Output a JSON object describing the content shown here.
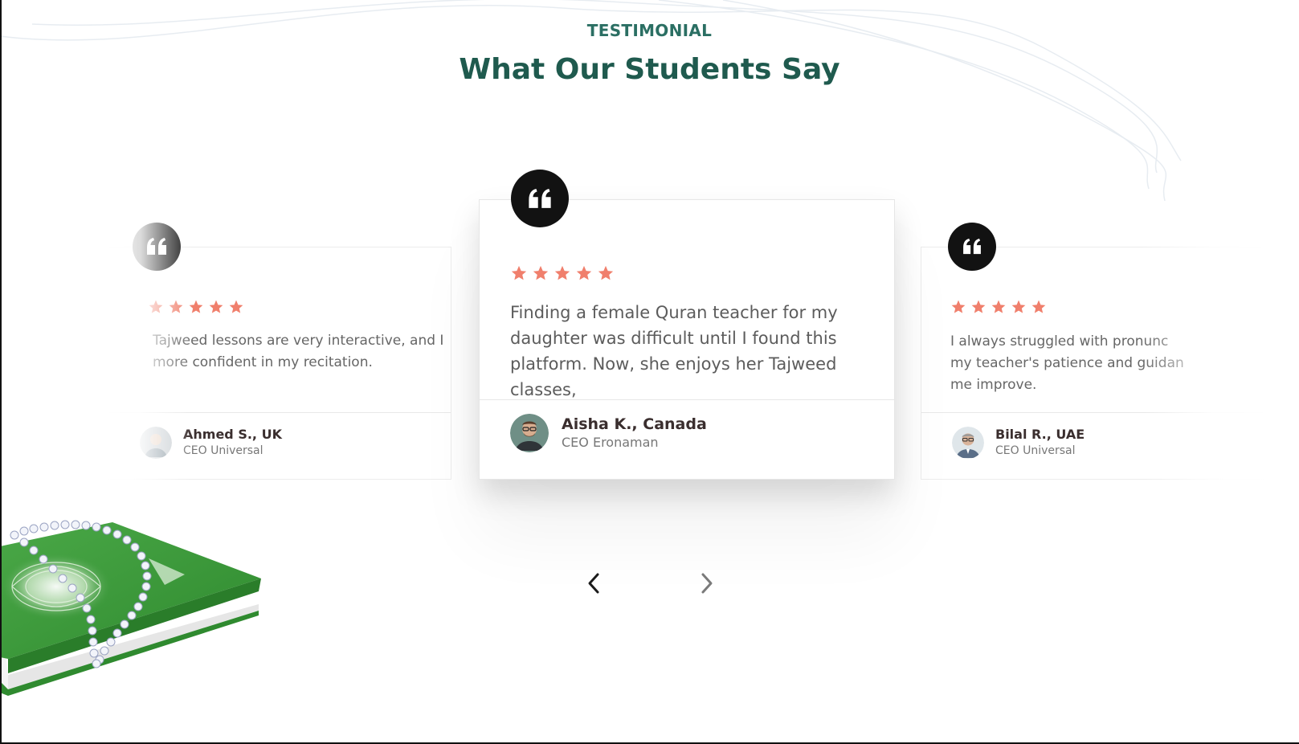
{
  "section": {
    "eyebrow": "TESTIMONIAL",
    "title": "What Our Students Say"
  },
  "colors": {
    "brand_green": "#1f5a4e",
    "eyebrow_green": "#2b6f63",
    "star": "#f07f6c",
    "quote_badge": "#121212"
  },
  "testimonials": [
    {
      "position": "previous",
      "rating": 5,
      "quote": "Tajweed lessons are very interactive, and I more confident in my recitation.",
      "lines": [
        "Tajweed lessons are very interactive, and I",
        "more confident in my recitation."
      ],
      "name": "Ahmed S., UK",
      "role": "CEO Universal"
    },
    {
      "position": "active",
      "rating": 5,
      "quote": "Finding a female Quran teacher for my daughter was difficult until I found this platform. Now, she enjoys her Tajweed classes,",
      "lines": [
        "Finding a female Quran teacher for my",
        "daughter was difficult until I found this",
        "platform. Now, she enjoys her Tajweed classes,"
      ],
      "name": "Aisha K., Canada",
      "role": "CEO Eronaman"
    },
    {
      "position": "next",
      "rating": 5,
      "quote": "I always struggled with pronunc my teacher's patience and guidan me improve.",
      "lines": [
        "I always struggled with pronunc",
        "my teacher's patience and guidan",
        "me improve."
      ],
      "name": "Bilal R., UAE",
      "role": "CEO Universal"
    }
  ],
  "carousel": {
    "prev_icon": "chevron-left-icon",
    "next_icon": "chevron-right-icon"
  },
  "icons": {
    "quote": "quote-icon",
    "star": "star-icon",
    "decoration": "quran-with-prayer-beads"
  }
}
